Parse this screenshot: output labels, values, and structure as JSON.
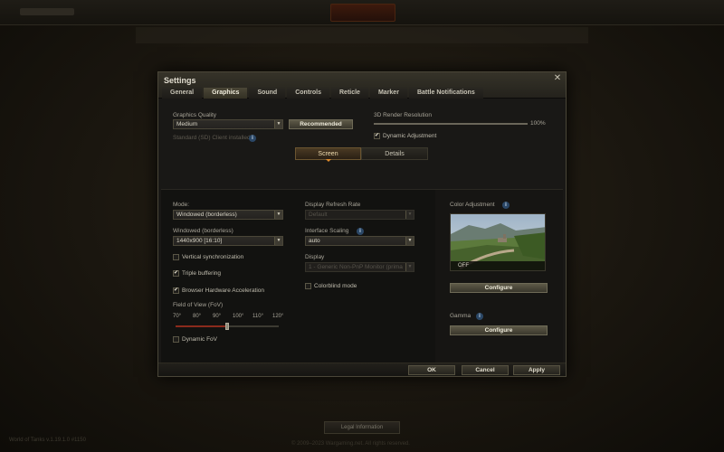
{
  "background": {
    "version": "World of Tanks v.1.19.1.0 #1150",
    "legal_label": "Legal Information",
    "copyright": "© 2009–2023 Wargaming.net. All rights reserved."
  },
  "window": {
    "title": "Settings",
    "tabs": [
      "General",
      "Graphics",
      "Sound",
      "Controls",
      "Reticle",
      "Marker",
      "Battle Notifications"
    ],
    "active_tab": "Graphics"
  },
  "graphics_quality": {
    "label": "Graphics Quality",
    "value": "Medium",
    "recommended_label": "Recommended",
    "client_note": "Standard (SD) Client installed"
  },
  "render_resolution": {
    "label": "3D Render Resolution",
    "value_text": "100%",
    "value": 1.0,
    "dynamic_adjustment_label": "Dynamic Adjustment",
    "dynamic_adjustment_checked": true
  },
  "subtabs": {
    "screen": "Screen",
    "details": "Details",
    "active": "Screen"
  },
  "screen": {
    "mode_label": "Mode:",
    "mode_value": "Windowed (borderless)",
    "resolution_label": "Windowed (borderless)",
    "resolution_value": "1440x900 [16:10]",
    "vsync_label": "Vertical synchronization",
    "vsync_checked": false,
    "triple_buffering_label": "Triple buffering",
    "triple_buffering_checked": true,
    "browser_hw_label": "Browser Hardware Acceleration",
    "browser_hw_checked": true,
    "fov_label": "Field of View (FoV)",
    "fov_ticks": [
      "70°",
      "80°",
      "90°",
      "100°",
      "110°",
      "120°"
    ],
    "fov_value": 95,
    "dynamic_fov_label": "Dynamic FoV",
    "dynamic_fov_checked": false,
    "refresh_rate_label": "Display Refresh Rate",
    "refresh_rate_value": "Default",
    "interface_scaling_label": "Interface Scaling",
    "interface_scaling_value": "auto",
    "display_label": "Display",
    "display_value": "1 - Generic Non-PnP Monitor (prima",
    "colorblind_label": "Colorblind mode",
    "colorblind_checked": false
  },
  "color_adjustment": {
    "label": "Color Adjustment",
    "preview_status": "OFF",
    "configure_label": "Configure"
  },
  "gamma": {
    "label": "Gamma",
    "configure_label": "Configure"
  },
  "footer": {
    "ok": "OK",
    "cancel": "Cancel",
    "apply": "Apply"
  },
  "colors": {
    "accent": "#e08a2a",
    "fov_range": "#8a2a1c",
    "info": "#2b4766"
  }
}
